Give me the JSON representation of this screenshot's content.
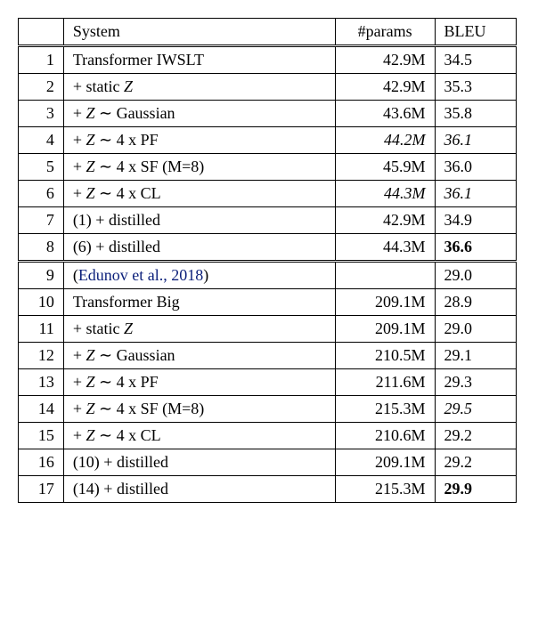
{
  "header": {
    "col1": "",
    "col2": "System",
    "col3": "#params",
    "col4": "BLEU"
  },
  "rows": [
    {
      "n": "1",
      "sys": "Transformer IWSLT",
      "params": "42.9M",
      "bleu": "34.5"
    },
    {
      "n": "2",
      "sys": "+ static",
      "params": "42.9M",
      "bleu": "35.3"
    },
    {
      "n": "3",
      "sys": "+",
      "z_rel": "∼ Gaussian",
      "params": "43.6M",
      "bleu": "35.8"
    },
    {
      "n": "4",
      "sys": "+",
      "z_rel": "∼ 4 x PF",
      "params": "44.2M",
      "bleu": "36.1"
    },
    {
      "n": "5",
      "sys": "+",
      "z_rel": "∼ 4 x SF (M=8)",
      "params": "45.9M",
      "bleu": "36.0"
    },
    {
      "n": "6",
      "sys": "+",
      "z_rel": "∼ 4 x CL",
      "params": "44.3M",
      "bleu": "36.1"
    },
    {
      "n": "7",
      "sys": "(1) + distilled",
      "params": "42.9M",
      "bleu": "34.9"
    },
    {
      "n": "8",
      "sys": "(6) + distilled",
      "params": "44.3M",
      "bleu": "36.6"
    },
    {
      "n": "9",
      "sys_cite": "Edunov et al., 2018",
      "params": "",
      "bleu": "29.0"
    },
    {
      "n": "10",
      "sys": "Transformer Big",
      "params": "209.1M",
      "bleu": "28.9"
    },
    {
      "n": "11",
      "sys": "+ static",
      "params": "209.1M",
      "bleu": "29.0"
    },
    {
      "n": "12",
      "sys": "+",
      "z_rel": "∼ Gaussian",
      "params": "210.5M",
      "bleu": "29.1"
    },
    {
      "n": "13",
      "sys": "+",
      "z_rel": "∼ 4 x PF",
      "params": "211.6M",
      "bleu": "29.3"
    },
    {
      "n": "14",
      "sys": "+",
      "z_rel": "∼ 4 x SF (M=8)",
      "params": "215.3M",
      "bleu": "29.5"
    },
    {
      "n": "15",
      "sys": "+",
      "z_rel": "∼ 4 x CL",
      "params": "210.6M",
      "bleu": "29.2"
    },
    {
      "n": "16",
      "sys": "(10) + distilled",
      "params": "209.1M",
      "bleu": "29.2"
    },
    {
      "n": "17",
      "sys": "(14) + distilled",
      "params": "215.3M",
      "bleu": "29.9"
    }
  ],
  "math": {
    "Z": "Z"
  },
  "chart_data": {
    "type": "table",
    "title": "",
    "columns": [
      "#",
      "System",
      "#params",
      "BLEU"
    ],
    "data": [
      [
        1,
        "Transformer IWSLT",
        "42.9M",
        34.5
      ],
      [
        2,
        "+ static Z",
        "42.9M",
        35.3
      ],
      [
        3,
        "+ Z ~ Gaussian",
        "43.6M",
        35.8
      ],
      [
        4,
        "+ Z ~ 4 x PF",
        "44.2M",
        36.1
      ],
      [
        5,
        "+ Z ~ 4 x SF (M=8)",
        "45.9M",
        36.0
      ],
      [
        6,
        "+ Z ~ 4 x CL",
        "44.3M",
        36.1
      ],
      [
        7,
        "(1) + distilled",
        "42.9M",
        34.9
      ],
      [
        8,
        "(6) + distilled",
        "44.3M",
        36.6
      ],
      [
        9,
        "(Edunov et al., 2018)",
        "",
        29.0
      ],
      [
        10,
        "Transformer Big",
        "209.1M",
        28.9
      ],
      [
        11,
        "+ static Z",
        "209.1M",
        29.0
      ],
      [
        12,
        "+ Z ~ Gaussian",
        "210.5M",
        29.1
      ],
      [
        13,
        "+ Z ~ 4 x PF",
        "211.6M",
        29.3
      ],
      [
        14,
        "+ Z ~ 4 x SF (M=8)",
        "215.3M",
        29.5
      ],
      [
        15,
        "+ Z ~ 4 x CL",
        "210.6M",
        29.2
      ],
      [
        16,
        "(10) + distilled",
        "209.1M",
        29.2
      ],
      [
        17,
        "(14) + distilled",
        "215.3M",
        29.9
      ]
    ]
  }
}
